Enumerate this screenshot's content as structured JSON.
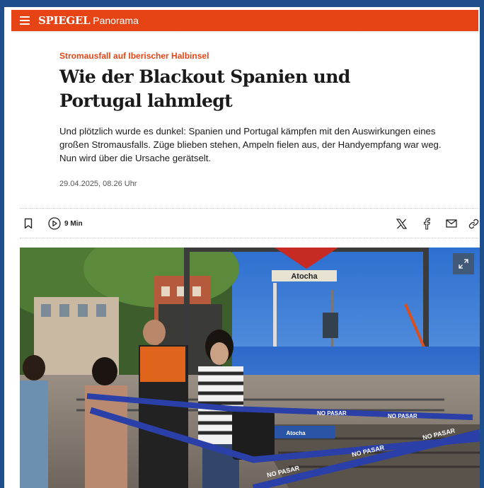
{
  "header": {
    "logo": "SPIEGEL",
    "section": "Panorama",
    "brand_color": "#e64415"
  },
  "article": {
    "kicker": "Stromausfall auf Iberischer Halbinsel",
    "title": "Wie der Blackout Spanien und Portugal lahmlegt",
    "teaser": "Und plötzlich wurde es dunkel: Spanien und Portugal kämpfen mit den Auswirkungen eines großen Stromausfalls. Züge blieben stehen, Ampeln fielen aus, der Handyempfang war weg. Nun wird über die Ursache gerätselt.",
    "date": "29.04.2025, 08.26 Uhr"
  },
  "toolbar": {
    "read_time": "9 Min",
    "icons": [
      "bookmark-icon",
      "play-icon",
      "x-icon",
      "facebook-icon",
      "mail-icon",
      "link-icon"
    ]
  },
  "image": {
    "station_sign": "Atocha",
    "tape_text": "NO PASAR",
    "icons": [
      "expand-icon"
    ]
  }
}
